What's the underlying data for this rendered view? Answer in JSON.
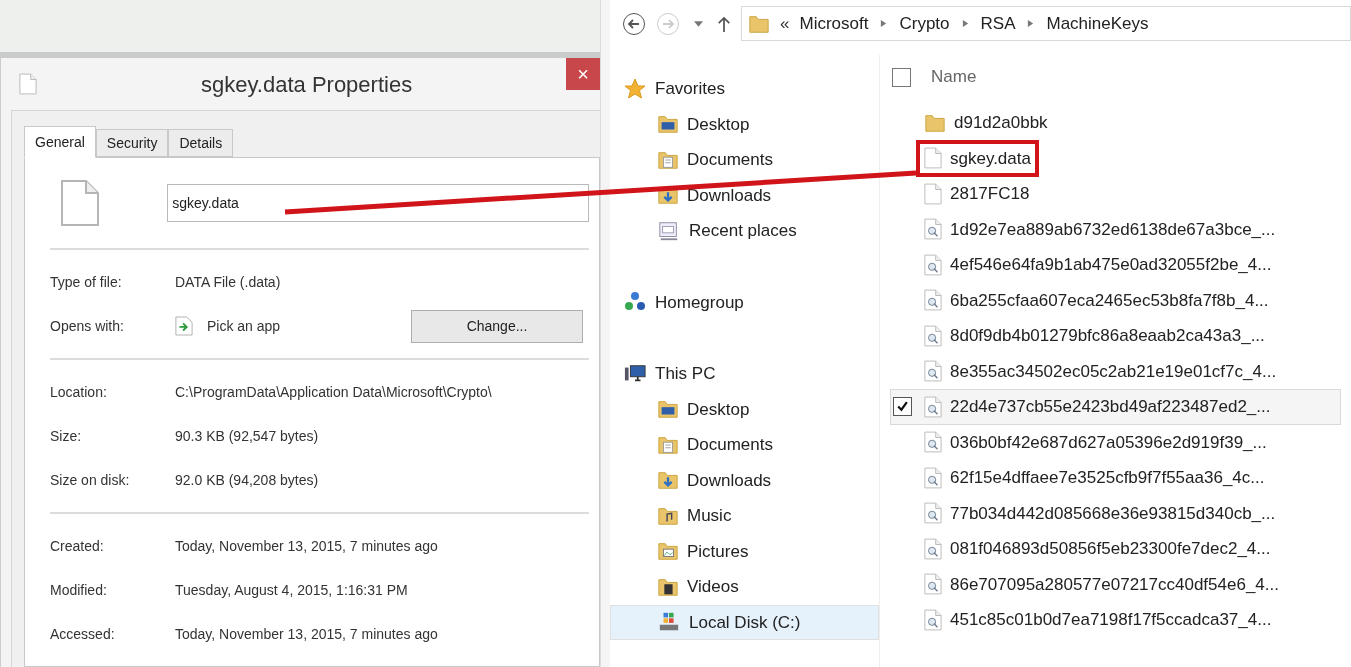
{
  "dialog": {
    "title": "sgkey.data Properties",
    "close": "×",
    "tabs": [
      {
        "label": "General",
        "selected": true
      },
      {
        "label": "Security",
        "selected": false
      },
      {
        "label": "Details",
        "selected": false
      }
    ],
    "filename": "sgkey.data",
    "groups": [
      [
        {
          "label": "Type of file:",
          "value": "DATA File (.data)",
          "kind": "text"
        },
        {
          "label": "Opens with:",
          "value": "Pick an app",
          "kind": "app",
          "button": "Change..."
        }
      ],
      [
        {
          "label": "Location:",
          "value": "C:\\ProgramData\\Application Data\\Microsoft\\Crypto\\",
          "kind": "text"
        },
        {
          "label": "Size:",
          "value": "90.3 KB (92,547 bytes)",
          "kind": "text"
        },
        {
          "label": "Size on disk:",
          "value": "92.0 KB (94,208 bytes)",
          "kind": "text"
        }
      ],
      [
        {
          "label": "Created:",
          "value": "Today, November 13, 2015, 7 minutes ago",
          "kind": "text"
        },
        {
          "label": "Modified:",
          "value": "Tuesday, August 4, 2015, 1:16:31 PM",
          "kind": "text"
        },
        {
          "label": "Accessed:",
          "value": "Today, November 13, 2015, 7 minutes ago",
          "kind": "text"
        }
      ]
    ]
  },
  "explorer": {
    "breadcrumb": {
      "prefix": "«",
      "parts": [
        "Microsoft",
        "Crypto",
        "RSA",
        "MachineKeys"
      ]
    },
    "nav": [
      {
        "label": "Favorites",
        "kind": "favorites",
        "selected": false,
        "children": [
          {
            "label": "Desktop",
            "kind": "desktop",
            "selected": false
          },
          {
            "label": "Documents",
            "kind": "documents",
            "selected": false
          },
          {
            "label": "Downloads",
            "kind": "downloads",
            "selected": false
          },
          {
            "label": "Recent places",
            "kind": "recent",
            "selected": false
          }
        ]
      },
      {
        "label": "Homegroup",
        "kind": "homegroup",
        "selected": false
      },
      {
        "label": "This PC",
        "kind": "pc",
        "selected": false,
        "children": [
          {
            "label": "Desktop",
            "kind": "desktop",
            "selected": false
          },
          {
            "label": "Documents",
            "kind": "documents",
            "selected": false
          },
          {
            "label": "Downloads",
            "kind": "downloads",
            "selected": false
          },
          {
            "label": "Music",
            "kind": "music",
            "selected": false
          },
          {
            "label": "Pictures",
            "kind": "pictures",
            "selected": false
          },
          {
            "label": "Videos",
            "kind": "videos",
            "selected": false
          },
          {
            "label": "Local Disk (C:)",
            "kind": "disk",
            "selected": true
          }
        ]
      }
    ],
    "column": {
      "label": "Name",
      "checked": false
    },
    "files": [
      {
        "name": "d91d2a0bbk",
        "kind": "folder",
        "selected": false,
        "annotated": false
      },
      {
        "name": "sgkey.data",
        "kind": "file",
        "selected": false,
        "annotated": true
      },
      {
        "name": "2817FC18",
        "kind": "file",
        "selected": false,
        "annotated": false
      },
      {
        "name": "1d92e7ea889ab6732ed6138de67a3bce_...",
        "kind": "key",
        "selected": false,
        "annotated": false
      },
      {
        "name": "4ef546e64fa9b1ab475e0ad32055f2be_4...",
        "kind": "key",
        "selected": false,
        "annotated": false
      },
      {
        "name": "6ba255cfaa607eca2465ec53b8fa7f8b_4...",
        "kind": "key",
        "selected": false,
        "annotated": false
      },
      {
        "name": "8d0f9db4b01279bfc86a8eaab2ca43a3_...",
        "kind": "key",
        "selected": false,
        "annotated": false
      },
      {
        "name": "8e355ac34502ec05c2ab21e19e01cf7c_4...",
        "kind": "key",
        "selected": false,
        "annotated": false
      },
      {
        "name": "22d4e737cb55e2423bd49af223487ed2_...",
        "kind": "key",
        "selected": true,
        "annotated": false
      },
      {
        "name": "036b0bf42e687d627a05396e2d919f39_...",
        "kind": "key",
        "selected": false,
        "annotated": false
      },
      {
        "name": "62f15e4dffaee7e3525cfb9f7f55aa36_4c...",
        "kind": "key",
        "selected": false,
        "annotated": false
      },
      {
        "name": "77b034d442d085668e36e93815d340cb_...",
        "kind": "key",
        "selected": false,
        "annotated": false
      },
      {
        "name": "081f046893d50856f5eb23300fe7dec2_4...",
        "kind": "key",
        "selected": false,
        "annotated": false
      },
      {
        "name": "86e707095a280577e07217cc40df54e6_4...",
        "kind": "key",
        "selected": false,
        "annotated": false
      },
      {
        "name": "451c85c01b0d7ea7198f17f5ccadca37_4...",
        "kind": "key",
        "selected": false,
        "annotated": false
      }
    ]
  }
}
